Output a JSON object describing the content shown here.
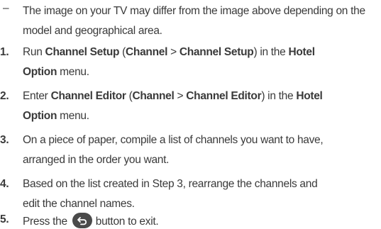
{
  "note": "The image on your TV may differ from the image above depending on the model and geographical area.",
  "steps": [
    {
      "num": "1.",
      "run": "Run ",
      "channel_setup": "Channel Setup",
      "paren_open": " (",
      "channel": "Channel",
      "arrow": " > ",
      "channel_setup_2": "Channel Setup",
      "paren_close": ") in the ",
      "hotel": "Hotel",
      "option": "Option",
      "menu": " menu."
    },
    {
      "num": "2.",
      "enter": "Enter ",
      "channel_editor": "Channel Editor",
      "paren_open": " (",
      "channel": "Channel",
      "arrow": " > ",
      "channel_editor_2": "Channel Editor",
      "paren_close": ") in the ",
      "hotel": "Hotel",
      "option": "Option",
      "menu": " menu."
    },
    {
      "num": "3.",
      "line1": "On a piece of paper, compile a list of channels you want to have,",
      "line2": "arranged in the order you want."
    },
    {
      "num": "4.",
      "line1": "Based on the list created in Step 3, rearrange the channels and",
      "line2": "edit the channel names."
    },
    {
      "num": "5.",
      "before": "Press the ",
      "icon": "back-button-icon",
      "after": " button to exit."
    }
  ]
}
